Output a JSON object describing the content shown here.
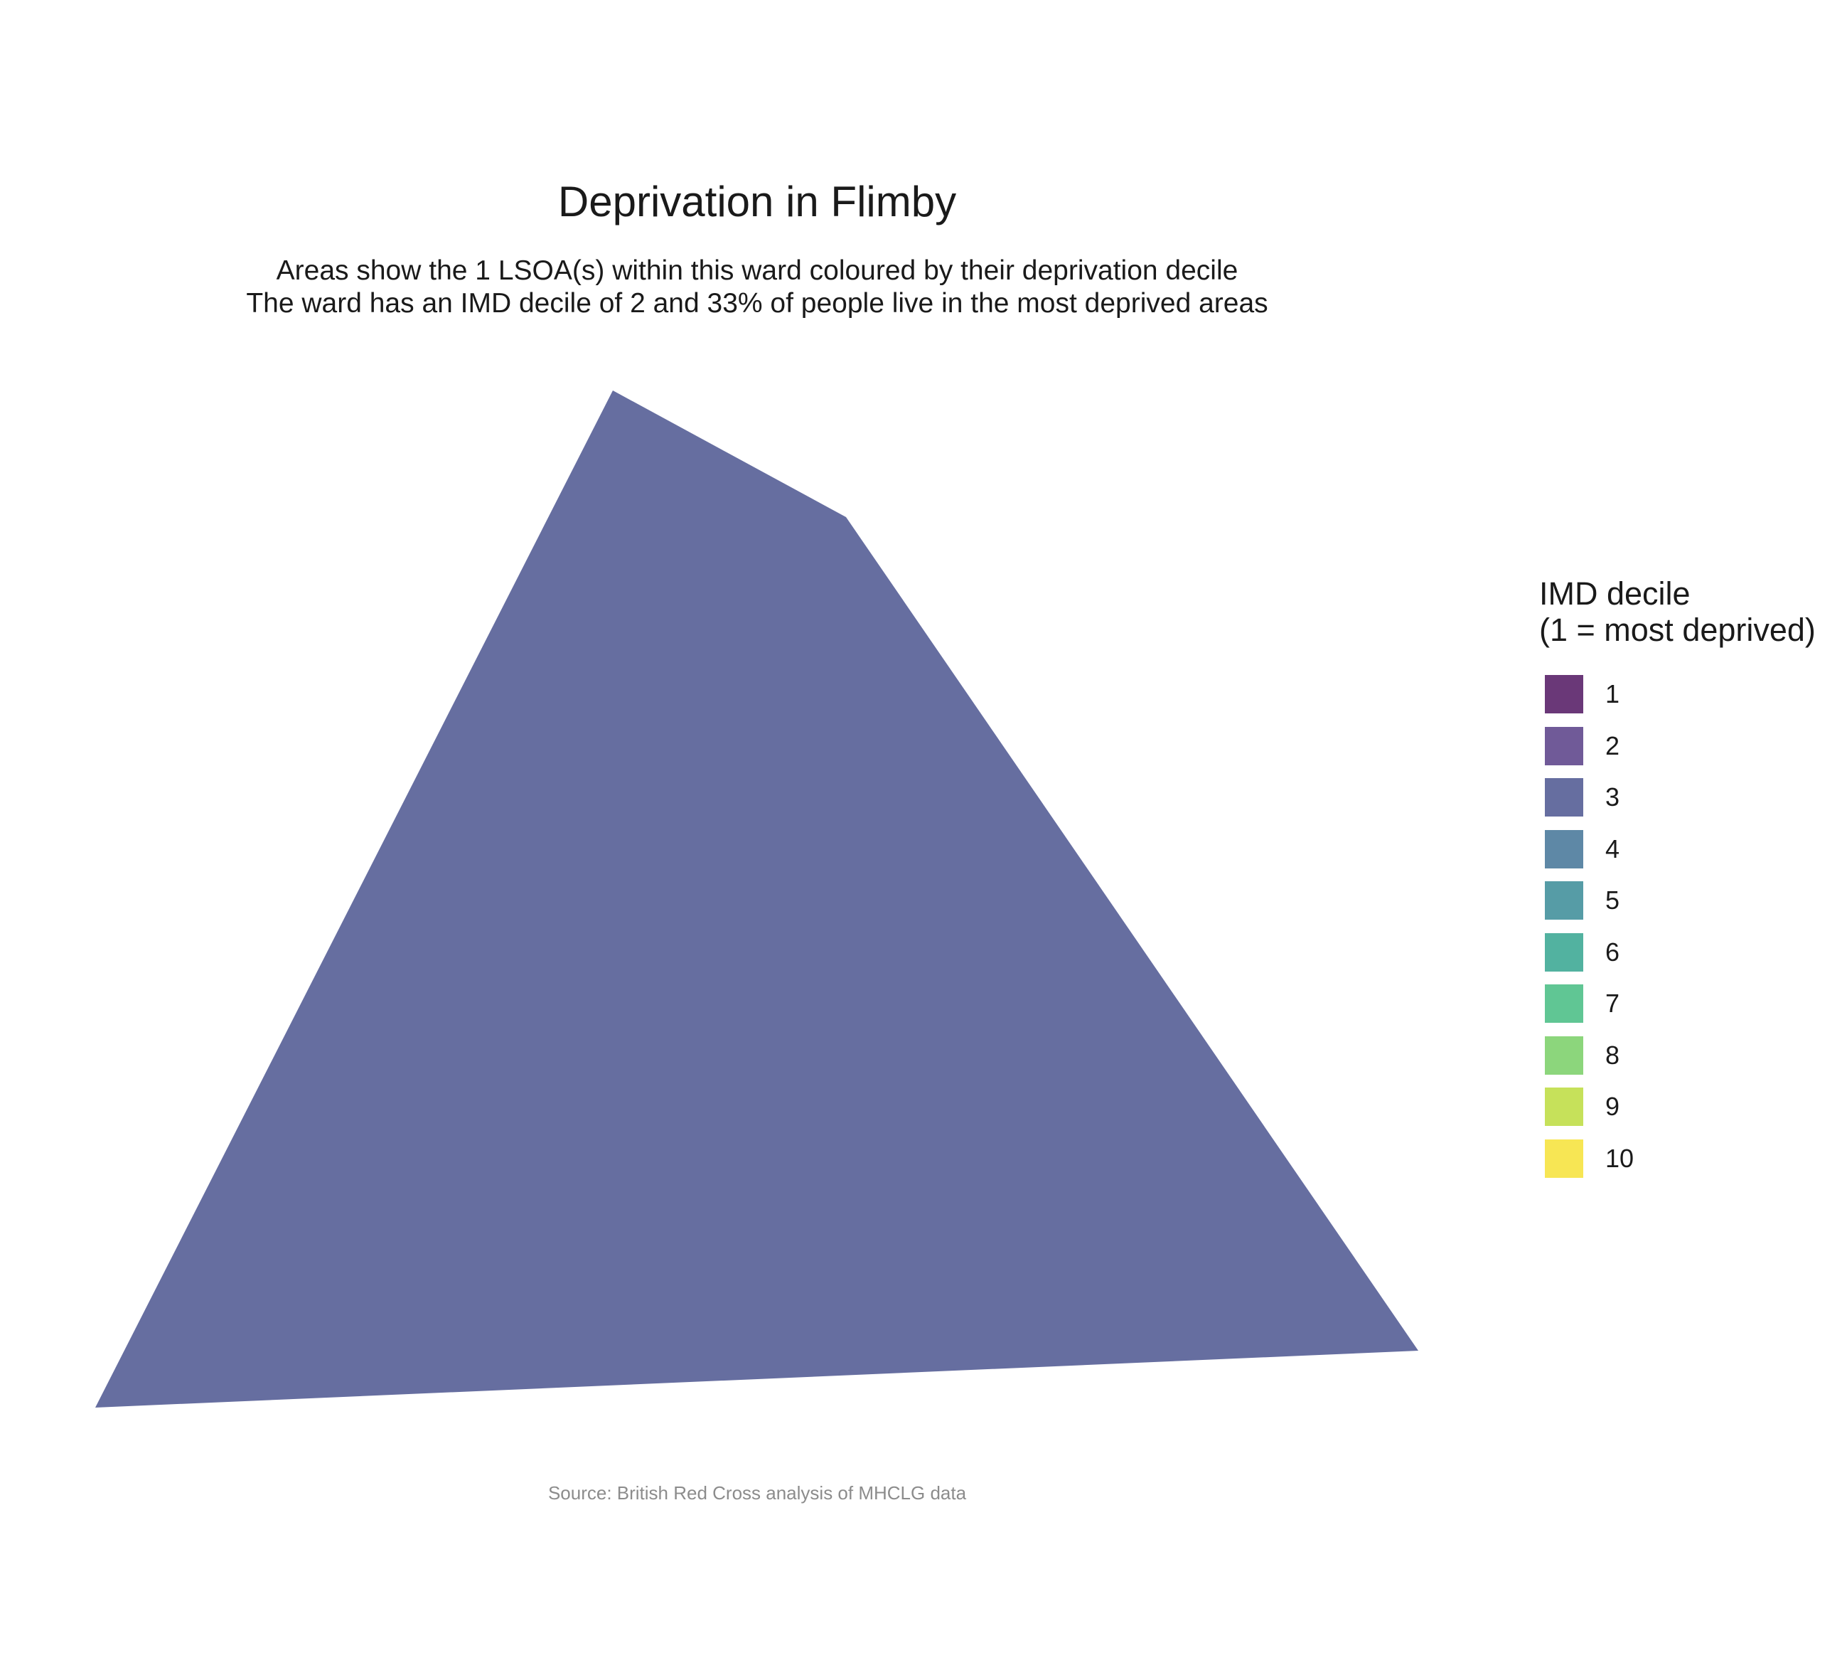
{
  "title": "Deprivation in Flimby",
  "subtitle": {
    "line1": "Areas show the 1 LSOA(s) within this ward coloured by their deprivation decile",
    "line2": "The ward has an IMD decile of 2 and 33% of people live in the most deprived areas"
  },
  "legend": {
    "title_line1": "IMD decile",
    "title_line2": "(1 = most deprived)",
    "items": [
      {
        "label": "1",
        "color": "#6a3878"
      },
      {
        "label": "2",
        "color": "#705a98"
      },
      {
        "label": "3",
        "color": "#666ea0"
      },
      {
        "label": "4",
        "color": "#5e88a6"
      },
      {
        "label": "5",
        "color": "#569ca6"
      },
      {
        "label": "6",
        "color": "#52b2a0"
      },
      {
        "label": "7",
        "color": "#60c694"
      },
      {
        "label": "8",
        "color": "#8cd67c"
      },
      {
        "label": "9",
        "color": "#c6e15a"
      },
      {
        "label": "10",
        "color": "#f7e654"
      }
    ]
  },
  "map": {
    "areas": [
      {
        "decile": 3,
        "color": "#666ea0"
      }
    ]
  },
  "caption": "Source: British Red Cross analysis of MHCLG data"
}
